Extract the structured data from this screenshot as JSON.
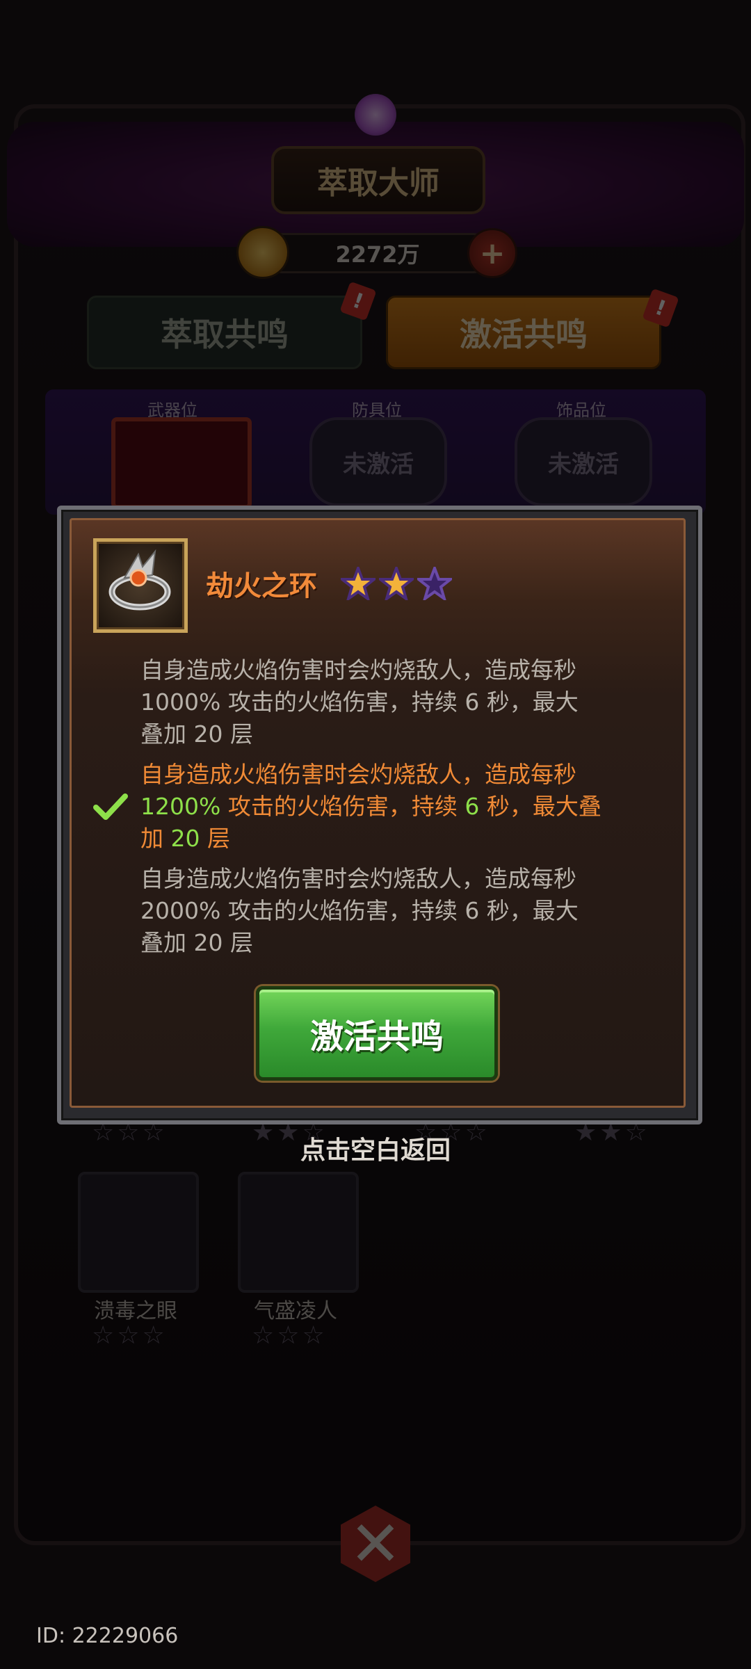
{
  "header": {
    "title": "萃取大师",
    "currency_value": "2272万",
    "currency_icon": "gold-coin-icon",
    "add_icon": "plus-icon"
  },
  "tabs": [
    {
      "label": "萃取共鸣",
      "badge": "!",
      "selected": false
    },
    {
      "label": "激活共鸣",
      "badge": "!",
      "selected": true
    }
  ],
  "slots": [
    {
      "label": "武器位",
      "status": ""
    },
    {
      "label": "防具位",
      "status": "未激活"
    },
    {
      "label": "饰品位",
      "status": "未激活"
    }
  ],
  "background_items": [
    {
      "name": "溃毒之眼",
      "stars_filled": 0
    },
    {
      "name": "气盛凌人",
      "stars_filled": 0
    }
  ],
  "dialog": {
    "item_name": "劫火之环",
    "item_icon": "ring-icon",
    "stars_total": 3,
    "stars_filled": 2,
    "levels": [
      {
        "line1": "自身造成火焰伤害时会灼烧敌人，造成每秒",
        "line2": "1000% 攻击的火焰伤害，持续 6 秒，最大",
        "line3": "叠加 20 层",
        "active": false
      },
      {
        "line1": "自身造成火焰伤害时会灼烧敌人，造成每秒",
        "line2_num": "1200%",
        "line2_mid": " 攻击的火焰伤害，持续 ",
        "line2_sec": "6",
        "line2_end": " 秒，最大叠",
        "line3_pre": "加 ",
        "line3_num": "20",
        "line3_end": " 层",
        "active": true
      },
      {
        "line1": "自身造成火焰伤害时会灼烧敌人，造成每秒",
        "line2": "2000% 攻击的火焰伤害，持续 6 秒，最大",
        "line3": "叠加 20 层",
        "active": false
      }
    ],
    "button_label": "激活共鸣",
    "colors": {
      "title": "#f28a3a",
      "active_text": "#f08a36",
      "highlight": "#8ee04a",
      "button": "#3fa83a"
    }
  },
  "hint_text": "点击空白返回",
  "player_id": "ID: 22229066"
}
